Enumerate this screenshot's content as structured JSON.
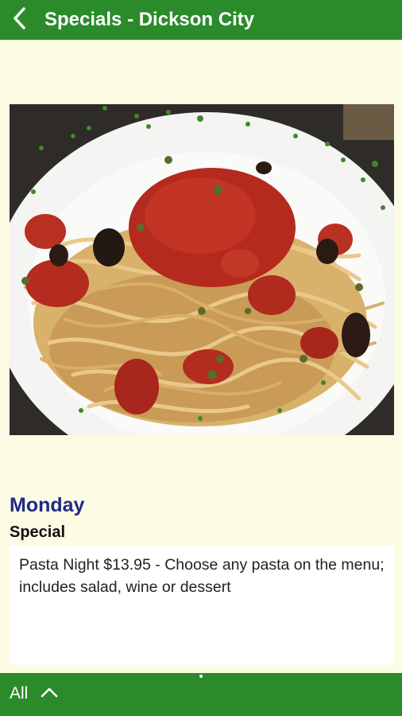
{
  "header": {
    "title": "Specials - Dickson City",
    "back_icon": "chevron-left-icon"
  },
  "special": {
    "day": "Monday",
    "label": "Special",
    "description": "Pasta Night $13.95 - Choose any pasta on the menu; includes salad, wine or dessert"
  },
  "footer": {
    "filter_label": "All",
    "expand_icon": "chevron-up-icon"
  },
  "colors": {
    "bar_green": "#2B8B2B",
    "background": "#FCFBE3",
    "day_heading": "#1F2A8A"
  }
}
